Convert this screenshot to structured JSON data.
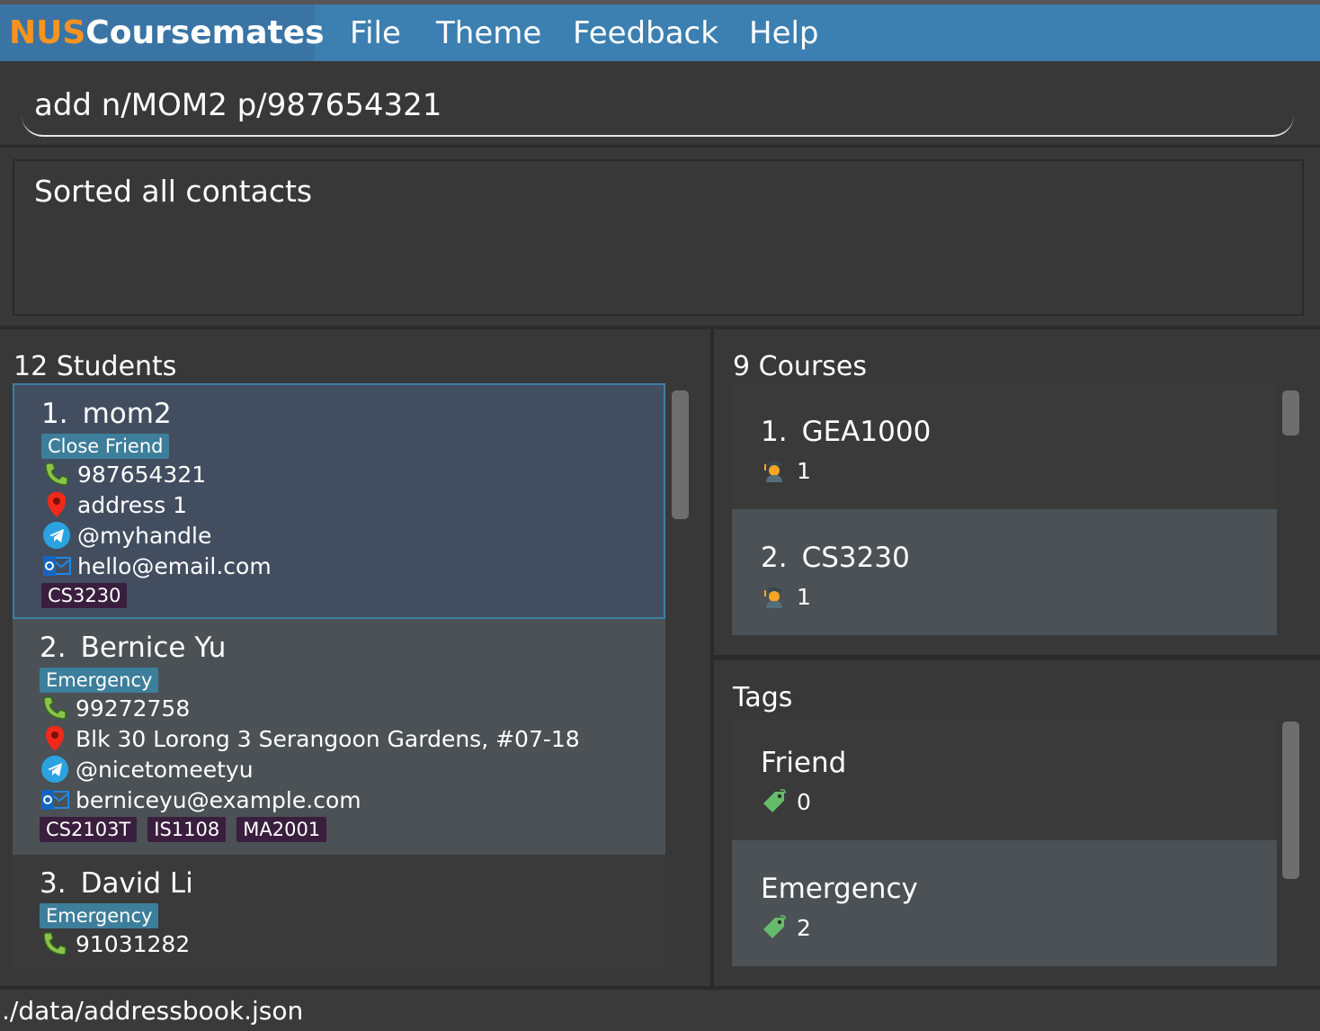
{
  "app": {
    "brand_part1": "NUS",
    "brand_part2": "Coursemates"
  },
  "menu": {
    "file": "File",
    "theme": "Theme",
    "feedback": "Feedback",
    "help": "Help"
  },
  "command": {
    "value": "add n/MOM2 p/987654321"
  },
  "result": {
    "text": "Sorted all contacts"
  },
  "students": {
    "title": "12 Students",
    "items": [
      {
        "index": "1.",
        "name": "mom2",
        "tag": "Close Friend",
        "phone": "987654321",
        "address": "address 1",
        "telegram": "@myhandle",
        "email": "hello@email.com",
        "courses": [
          "CS3230"
        ]
      },
      {
        "index": "2.",
        "name": "Bernice Yu",
        "tag": "Emergency",
        "phone": "99272758",
        "address": "Blk 30 Lorong 3 Serangoon Gardens, #07-18",
        "telegram": "@nicetomeetyu",
        "email": "berniceyu@example.com",
        "courses": [
          "CS2103T",
          "IS1108",
          "MA2001"
        ]
      },
      {
        "index": "3.",
        "name": "David Li",
        "tag": "Emergency",
        "phone": "91031282"
      }
    ]
  },
  "courses": {
    "title": "9 Courses",
    "items": [
      {
        "index": "1.",
        "code": "GEA1000",
        "count": "1"
      },
      {
        "index": "2.",
        "code": "CS3230",
        "count": "1"
      }
    ]
  },
  "tags": {
    "title": "Tags",
    "items": [
      {
        "name": "Friend",
        "count": "0"
      },
      {
        "name": "Emergency",
        "count": "2"
      }
    ]
  },
  "status": {
    "path": "./data/addressbook.json"
  },
  "colors": {
    "menu_bg": "#3c7fb1",
    "brand_orange": "#f7931e",
    "tag_bg": "#3d7e9a",
    "course_tag_bg": "#3a1e3e",
    "selected_border": "#3d7fa3"
  },
  "icons": {
    "phone": "phone-icon",
    "address": "location-pin-icon",
    "telegram": "telegram-icon",
    "email": "outlook-email-icon",
    "student": "student-icon",
    "tag": "tag-icon"
  }
}
